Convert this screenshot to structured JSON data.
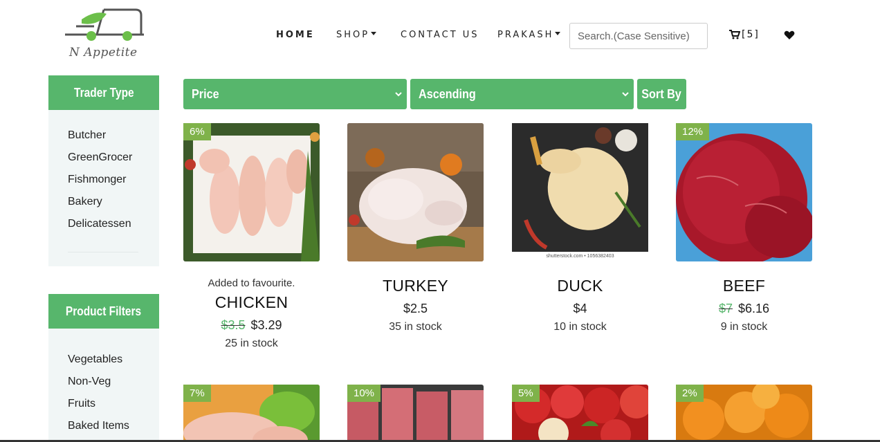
{
  "brand": {
    "logo_text": "N Appetite"
  },
  "nav": {
    "home": "HOME",
    "shop": "SHOP",
    "contact": "CONTACT US",
    "user": "PRAKASH",
    "search_placeholder": "Search.(Case Sensitive)",
    "cart_count": "[5]"
  },
  "sidebar": {
    "trader_title": "Trader Type",
    "trader_items": [
      "Butcher",
      "GreenGrocer",
      "Fishmonger",
      "Bakery",
      "Delicatessen"
    ],
    "product_title": "Product Filters",
    "product_items": [
      "Vegetables",
      "Non-Veg",
      "Fruits",
      "Baked Items"
    ]
  },
  "filters": {
    "sort_field": "Price",
    "sort_order": "Ascending",
    "sort_button": "Sort By"
  },
  "products": [
    {
      "name": "CHICKEN",
      "badge": "6%",
      "old_price": "$3.5",
      "price": "$3.29",
      "stock": "25 in stock",
      "message": "Added to favourite."
    },
    {
      "name": "TURKEY",
      "price": "$2.5",
      "stock": "35 in stock"
    },
    {
      "name": "DUCK",
      "price": "$4",
      "stock": "10 in stock",
      "watermark": "shutterstock.com • 1056382403"
    },
    {
      "name": "BEEF",
      "badge": "12%",
      "old_price": "$7",
      "price": "$6.16",
      "stock": "9 in stock"
    }
  ],
  "products_row2": [
    {
      "badge": "7%"
    },
    {
      "badge": "10%"
    },
    {
      "badge": "5%"
    },
    {
      "badge": "2%"
    }
  ],
  "colors": {
    "accent": "#57b66c",
    "badge": "#7fb24a",
    "sidebar_bg": "#f1f6f6"
  }
}
